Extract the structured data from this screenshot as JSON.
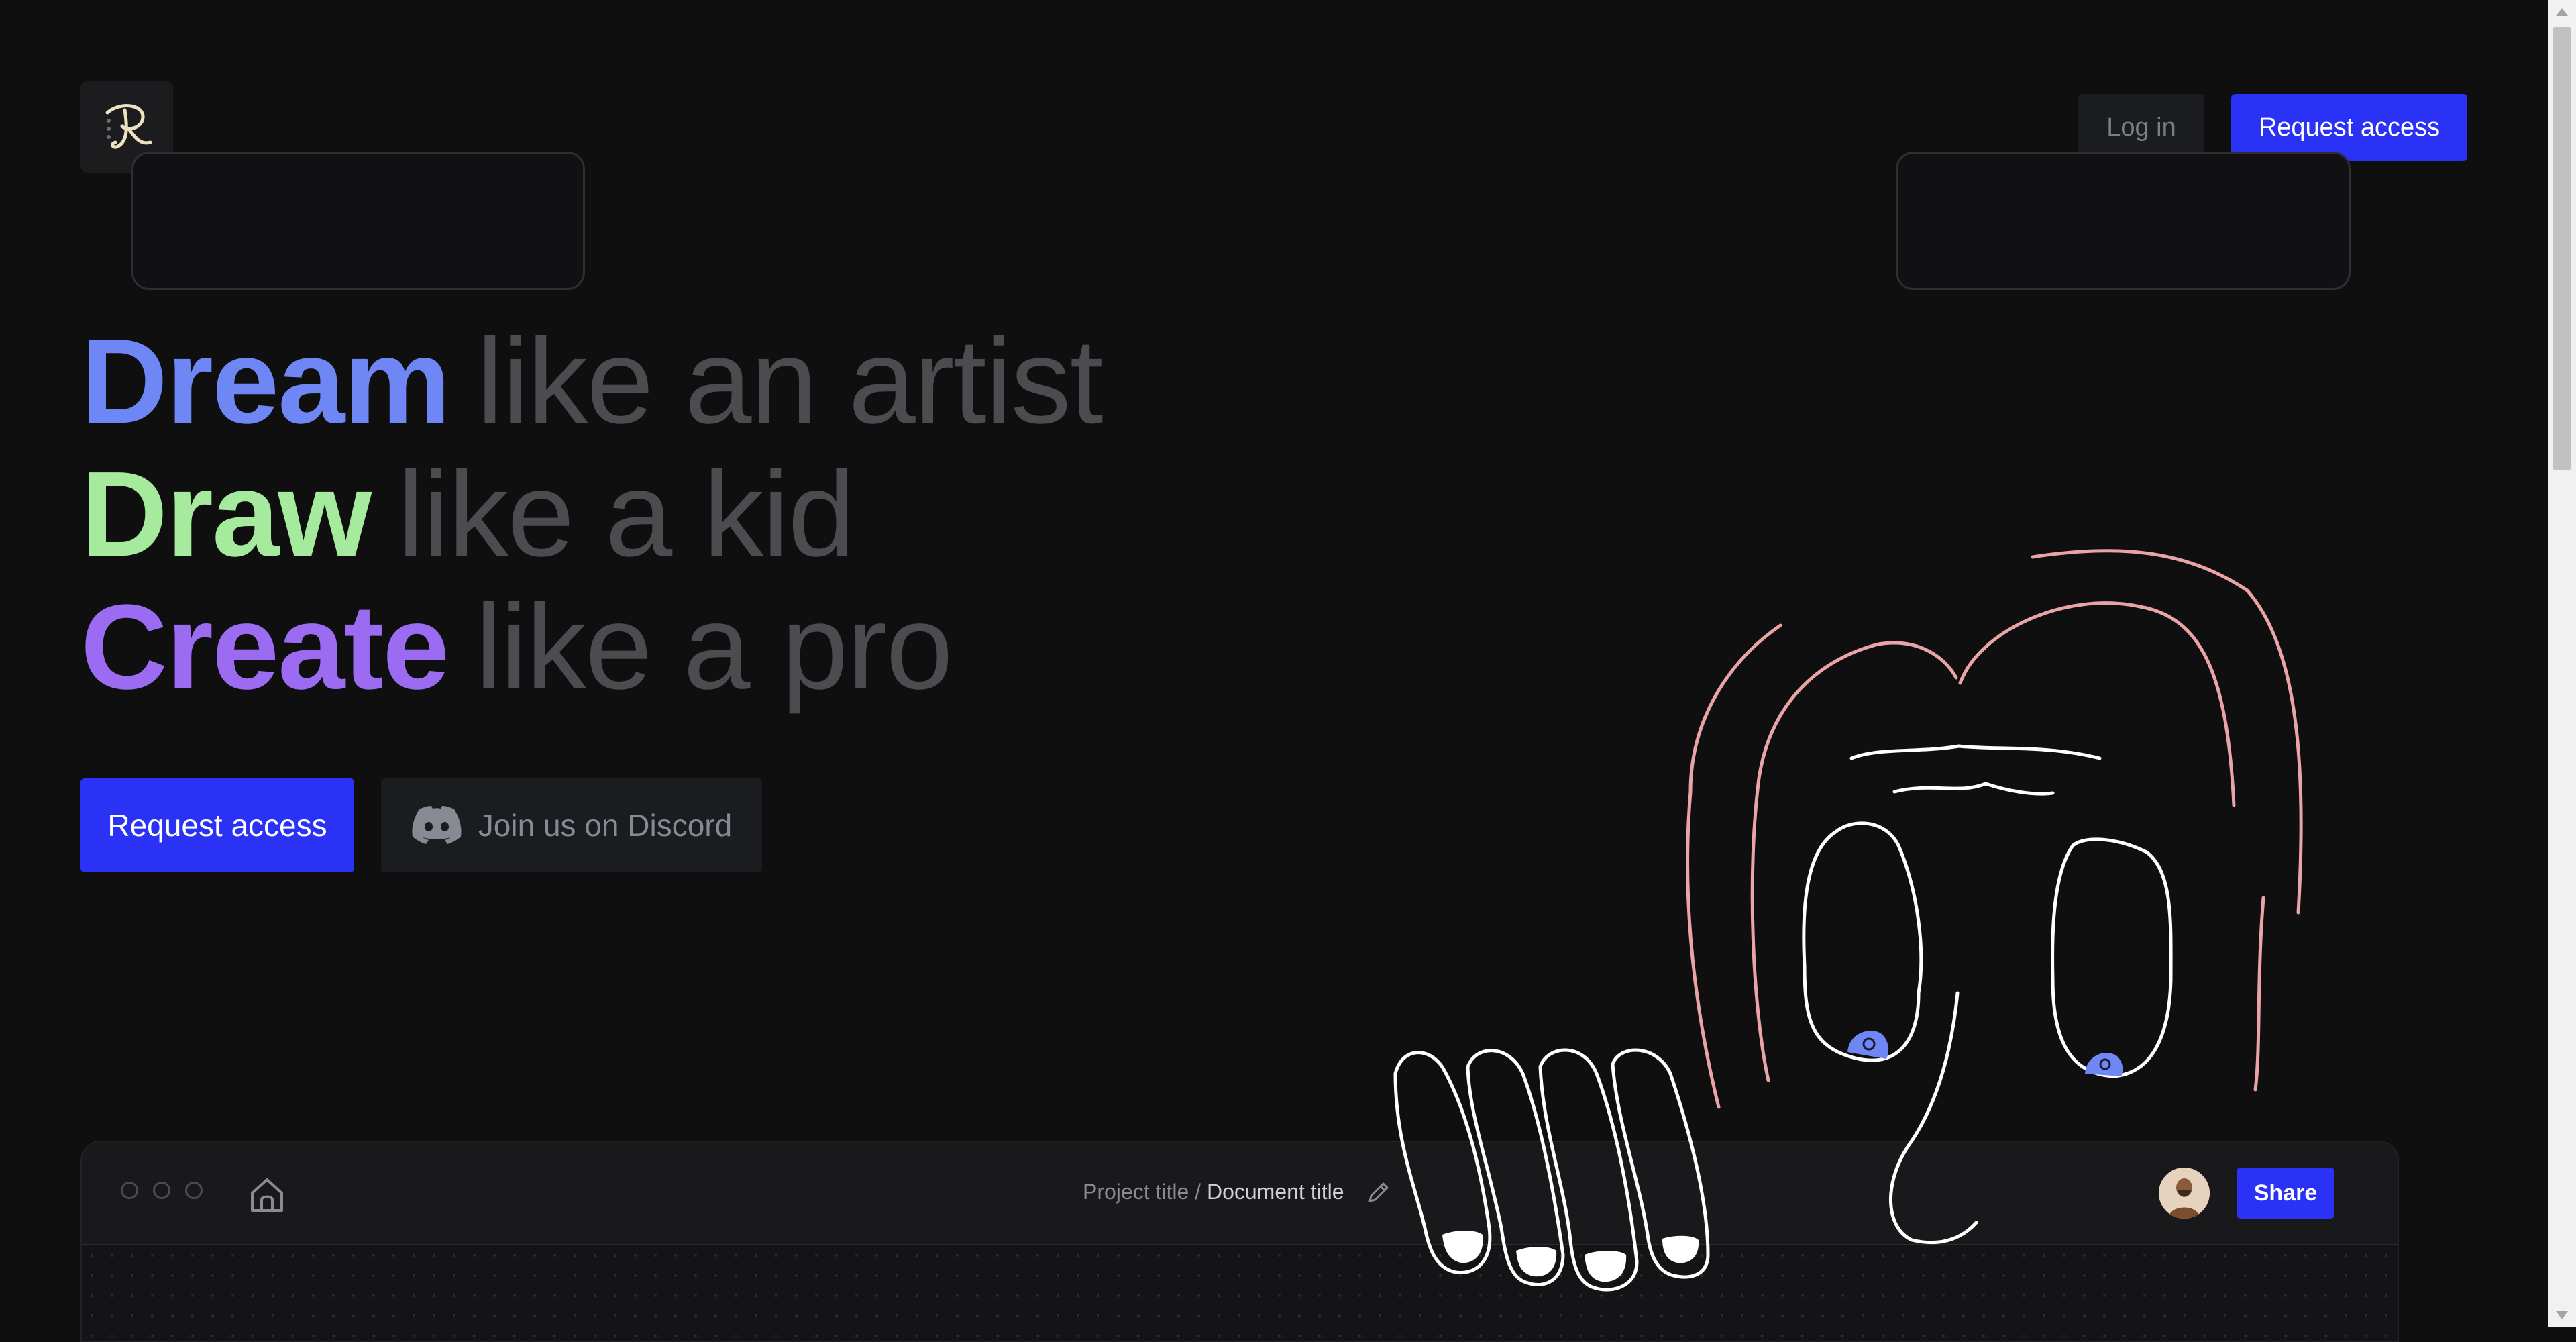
{
  "header": {
    "logo_text": "R",
    "login_label": "Log in",
    "request_access_label": "Request access"
  },
  "hero": {
    "lines": [
      {
        "word": "Dream",
        "rest": "like an artist"
      },
      {
        "word": "Draw",
        "rest": "like a kid"
      },
      {
        "word": "Create",
        "rest": "like a pro"
      }
    ],
    "request_access_label": "Request access",
    "discord_label": "Join us on Discord"
  },
  "app_preview": {
    "project_title": "Project title / ",
    "document_title": "Document title",
    "share_label": "Share"
  },
  "colors": {
    "accent": "#2a33f5",
    "dream": "#6f86f5",
    "draw": "#a6ea9d",
    "create": "#9b6cf2",
    "background": "#0f0f10"
  }
}
